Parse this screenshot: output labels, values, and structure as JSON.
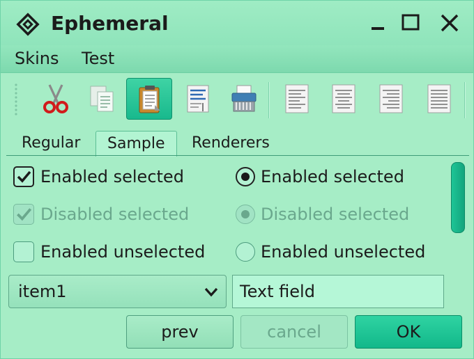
{
  "window": {
    "title": "Ephemeral"
  },
  "menubar": {
    "items": [
      {
        "label": "Skins"
      },
      {
        "label": "Test"
      }
    ]
  },
  "toolbar": {
    "buttons": [
      {
        "icon": "scissors-icon"
      },
      {
        "icon": "copy-icon"
      },
      {
        "icon": "clipboard-icon",
        "active": true
      },
      {
        "icon": "document-icon"
      },
      {
        "icon": "shredder-icon"
      },
      {
        "icon": "align-left-icon"
      },
      {
        "icon": "align-center-icon"
      },
      {
        "icon": "align-right-icon"
      },
      {
        "icon": "align-justify-icon"
      }
    ]
  },
  "tabs": [
    {
      "label": "Regular"
    },
    {
      "label": "Sample",
      "selected": true
    },
    {
      "label": "Renderers"
    }
  ],
  "checkboxes": [
    {
      "label": "Enabled selected",
      "checked": true,
      "enabled": true
    },
    {
      "label": "Disabled selected",
      "checked": true,
      "enabled": false
    },
    {
      "label": "Enabled unselected",
      "checked": false,
      "enabled": true
    }
  ],
  "radios": [
    {
      "label": "Enabled selected",
      "checked": true,
      "enabled": true
    },
    {
      "label": "Disabled selected",
      "checked": true,
      "enabled": false
    },
    {
      "label": "Enabled unselected",
      "checked": false,
      "enabled": true
    }
  ],
  "combo": {
    "value": "item1"
  },
  "textfield": {
    "value": "Text field"
  },
  "buttons": {
    "prev": "prev",
    "cancel": "cancel",
    "ok": "OK"
  },
  "colors": {
    "accent": "#1ec596",
    "background": "#a6edc6",
    "disabled_text": "#6aa88d"
  }
}
